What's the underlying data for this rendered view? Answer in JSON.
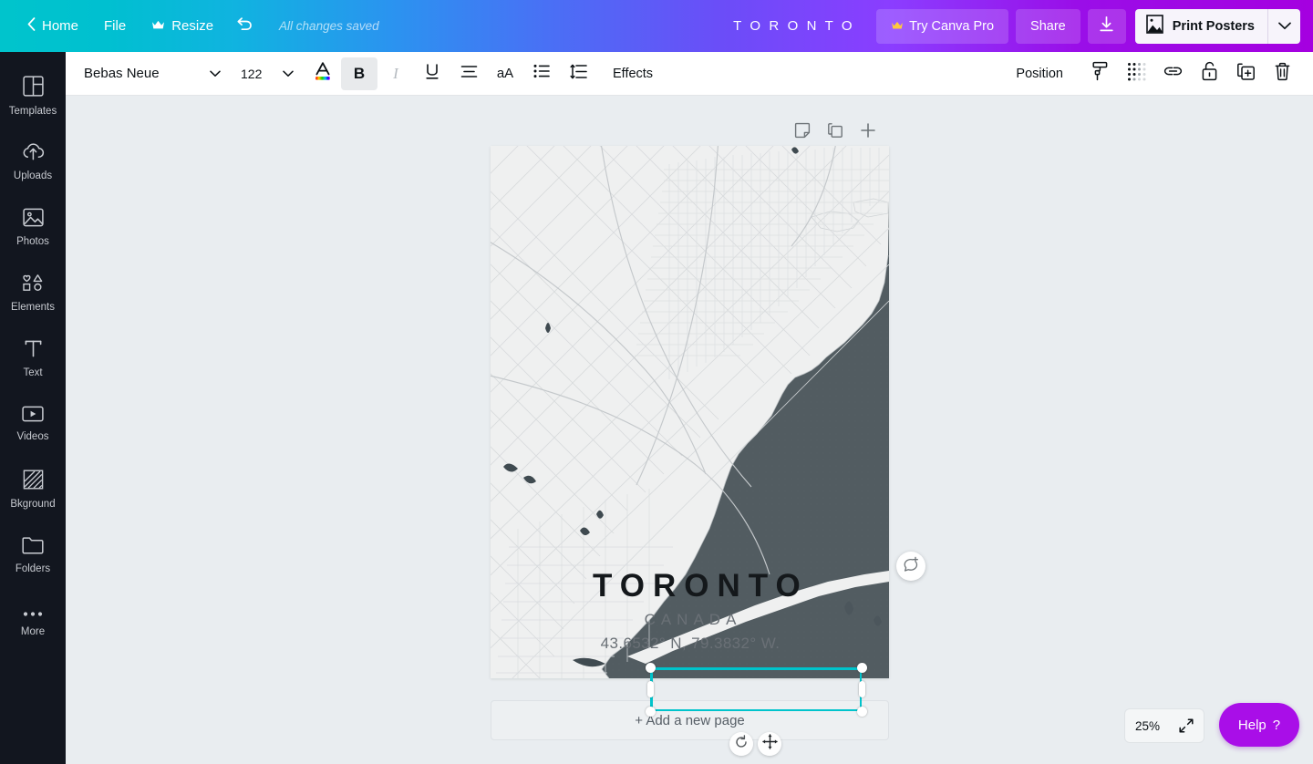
{
  "topbar": {
    "back_icon": "chevron-left-icon",
    "home_label": "Home",
    "file_label": "File",
    "resize_label": "Resize",
    "resize_icon": "crown-icon",
    "undo_icon": "undo-arrow-icon",
    "status_text": "All changes saved",
    "doc_title": "T O R O N T O",
    "try_pro_label": "Try Canva Pro",
    "try_pro_icon": "crown-icon",
    "share_label": "Share",
    "download_icon": "download-arrow-icon",
    "print_label": "Print Posters",
    "print_icon": "poster-image-icon",
    "print_caret_icon": "chevron-down-icon",
    "gradient_start": "#00c4cc",
    "gradient_end": "#a500e0"
  },
  "sidebar": {
    "items": [
      {
        "label": "Templates",
        "icon": "templates-grid-icon"
      },
      {
        "label": "Uploads",
        "icon": "cloud-upload-icon"
      },
      {
        "label": "Photos",
        "icon": "photo-image-icon"
      },
      {
        "label": "Elements",
        "icon": "shapes-icon"
      },
      {
        "label": "Text",
        "icon": "text-t-icon"
      },
      {
        "label": "Videos",
        "icon": "video-play-icon"
      },
      {
        "label": "Bkground",
        "icon": "hatch-pattern-icon"
      },
      {
        "label": "Folders",
        "icon": "folder-icon"
      },
      {
        "label": "More",
        "icon": "ellipsis-icon"
      }
    ],
    "background": "#12161f"
  },
  "toolbar": {
    "font_name": "Bebas Neue",
    "font_caret_icon": "chevron-down-icon",
    "font_size": "122",
    "size_caret_icon": "chevron-down-icon",
    "text_color_icon": "font-color-a-icon",
    "bold_label": "B",
    "bold_active": true,
    "italic_label": "I",
    "italic_active": false,
    "underline_label": "U",
    "align_icon": "text-align-icon",
    "case_label": "aA",
    "list_icon": "bullet-list-icon",
    "spacing_icon": "line-spacing-icon",
    "effects_label": "Effects",
    "position_label": "Position",
    "copy_style_icon": "paint-roller-icon",
    "transparency_icon": "transparency-dots-icon",
    "link_icon": "link-chain-icon",
    "lock_icon": "lock-icon",
    "duplicate_icon": "duplicate-icon",
    "delete_icon": "trash-icon"
  },
  "canvas": {
    "page_tools": [
      {
        "icon": "notes-page-icon",
        "name": "notes"
      },
      {
        "icon": "duplicate-page-icon",
        "name": "duplicate-page"
      },
      {
        "icon": "plus-icon",
        "name": "add-page"
      }
    ],
    "comment_icon": "add-comment-icon",
    "rotate_icon": "rotate-handle-icon",
    "move_icon": "move-cursor-icon",
    "add_page_label": "+ Add a new page",
    "selection_color": "#00c4cc",
    "page_background": "#f0f1f1",
    "workspace_background": "#e9edf0"
  },
  "poster": {
    "city": "TORONTO",
    "country": "CANADA",
    "coordinates": "43.6532° N, 79.3832° W.",
    "map_land_color": "#eff0f0",
    "map_water_color": "#525c61",
    "map_road_color": "#d7dadc",
    "city_text_color": "#14181b",
    "subtext_color": "#6a7076"
  },
  "footer": {
    "zoom_level": "25%",
    "expand_icon": "expand-arrows-icon",
    "help_label": "Help",
    "help_mark": "?",
    "help_color": "#a90ee8"
  }
}
